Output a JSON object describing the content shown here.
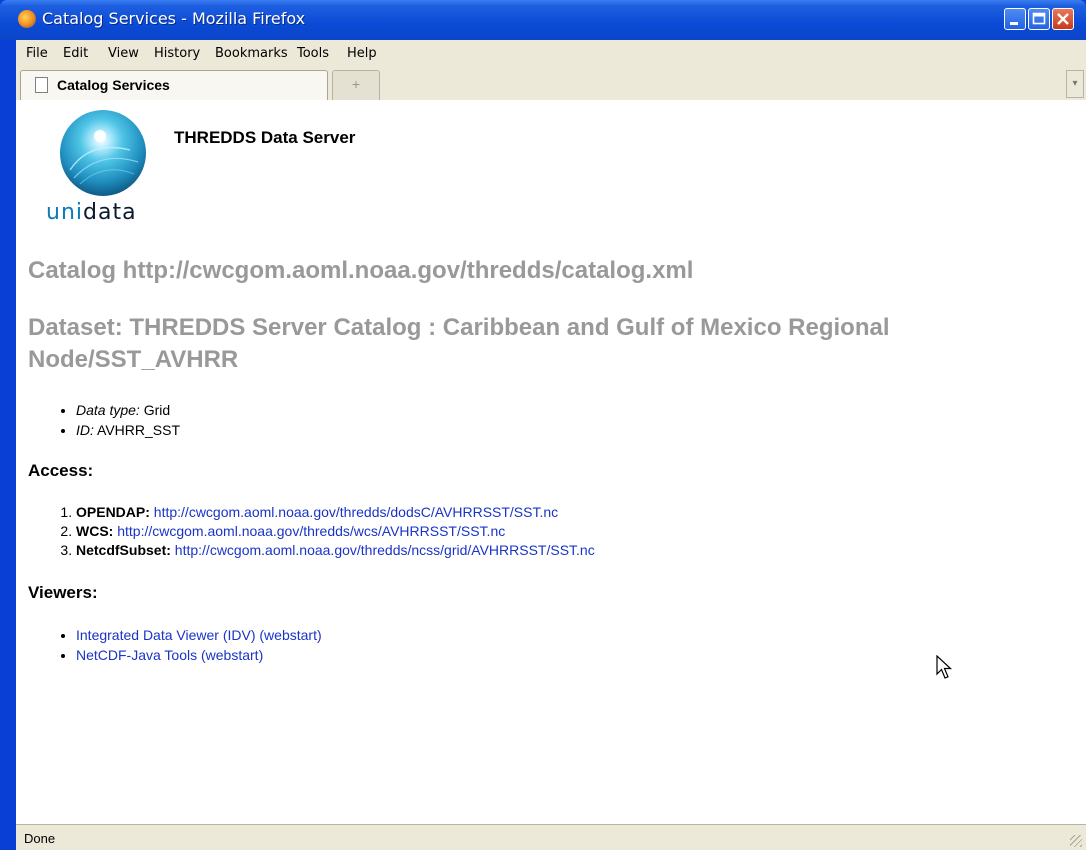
{
  "window": {
    "title": "Catalog Services - Mozilla Firefox"
  },
  "menu": {
    "items": [
      "File",
      "Edit",
      "View",
      "History",
      "Bookmarks",
      "Tools",
      "Help"
    ]
  },
  "tabs": {
    "active_label": "Catalog Services",
    "new_tab_glyph": "+",
    "list_glyph": "▾"
  },
  "page": {
    "logo_text_part1": "uni",
    "logo_text_part2": "data",
    "server_title": "THREDDS Data Server",
    "catalog_heading": "Catalog http://cwcgom.aoml.noaa.gov/thredds/catalog.xml",
    "dataset_heading": "Dataset: THREDDS Server Catalog : Caribbean and Gulf of Mexico Regional Node/SST_AVHRR",
    "properties": [
      {
        "label": "Data type:",
        "value": "Grid"
      },
      {
        "label": "ID:",
        "value": "AVHRR_SST"
      }
    ],
    "access_heading": "Access:",
    "access": [
      {
        "service": "OPENDAP:",
        "url": "http://cwcgom.aoml.noaa.gov/thredds/dodsC/AVHRRSST/SST.nc"
      },
      {
        "service": "WCS:",
        "url": "http://cwcgom.aoml.noaa.gov/thredds/wcs/AVHRRSST/SST.nc"
      },
      {
        "service": "NetcdfSubset:",
        "url": "http://cwcgom.aoml.noaa.gov/thredds/ncss/grid/AVHRRSST/SST.nc"
      }
    ],
    "viewers_heading": "Viewers:",
    "viewers": [
      "Integrated Data Viewer (IDV) (webstart)",
      "NetCDF-Java Tools (webstart)"
    ]
  },
  "status": {
    "text": "Done"
  }
}
